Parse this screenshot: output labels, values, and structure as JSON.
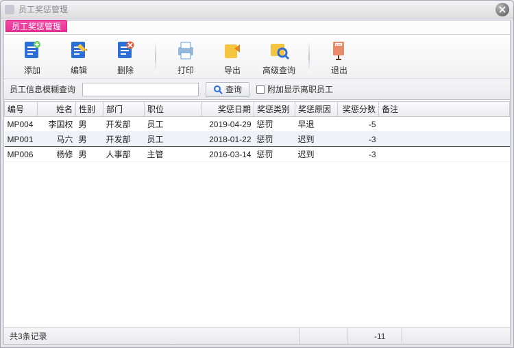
{
  "window": {
    "title": "员工奖惩管理"
  },
  "tab": {
    "label": "员工奖惩管理"
  },
  "toolbar": {
    "add": "添加",
    "edit": "编辑",
    "delete": "删除",
    "print": "打印",
    "export": "导出",
    "adv_query": "高级查询",
    "exit": "退出"
  },
  "search": {
    "label": "员工信息模糊查询",
    "value": "",
    "query_btn": "查询",
    "append_checkbox": "附加显示离职员工",
    "append_checked": false
  },
  "columns": {
    "id": "编号",
    "name": "姓名",
    "sex": "性别",
    "dept": "部门",
    "pos": "职位",
    "date": "奖惩日期",
    "type": "奖惩类别",
    "reason": "奖惩原因",
    "score": "奖惩分数",
    "note": "备注"
  },
  "rows": [
    {
      "id": "MP004",
      "name": "李国权",
      "sex": "男",
      "dept": "开发部",
      "pos": "员工",
      "date": "2019-04-29",
      "type": "惩罚",
      "reason": "早退",
      "score": "-5",
      "note": ""
    },
    {
      "id": "MP001",
      "name": "马六",
      "sex": "男",
      "dept": "开发部",
      "pos": "员工",
      "date": "2018-01-22",
      "type": "惩罚",
      "reason": "迟到",
      "score": "-3",
      "note": ""
    },
    {
      "id": "MP006",
      "name": "杨修",
      "sex": "男",
      "dept": "人事部",
      "pos": "主管",
      "date": "2016-03-14",
      "type": "惩罚",
      "reason": "迟到",
      "score": "-3",
      "note": ""
    }
  ],
  "selected_row": 1,
  "status": {
    "count_label": "共3条记录",
    "sum": "-11"
  },
  "icons": {
    "add": "#2b6fd6",
    "edit": "#2b6fd6",
    "delete": "#2b6fd6",
    "print": "#5aa0e6",
    "export": "#f5a623",
    "adv_query": "#f5a623",
    "exit": "#e25b3a"
  }
}
